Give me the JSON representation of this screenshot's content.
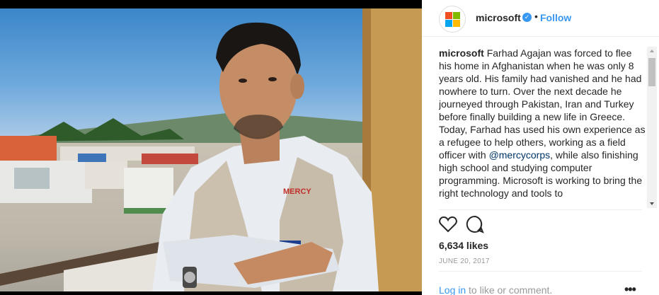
{
  "post": {
    "username": "microsoft",
    "follow_label": "Follow",
    "separator": "•",
    "verified_glyph": "✓",
    "caption_user": "microsoft",
    "caption_part1": "Farhad Agajan was forced to flee his home in Afghanistan when he was only 8 years old. His family had vanished and he had nowhere to turn. Over the next decade he journeyed through Pakistan, Iran and Turkey before finally building a new life in Greece. Today, Farhad has used his own experience as a refugee to help others, working as a field officer with",
    "mention": "@mercycorps",
    "caption_part2": ", while also finishing high school and studying computer programming. Microsoft is working to bring the right technology and tools to",
    "likes": "6,634 likes",
    "date": "JUNE 20, 2017",
    "login_link": "Log in",
    "login_rest": " to like or comment.",
    "more_label": "•••"
  },
  "colors": {
    "accent": "#3897f0",
    "text": "#262626",
    "muted": "#999999",
    "logo_red": "#f25022",
    "logo_green": "#7fba00",
    "logo_blue": "#00a4ef",
    "logo_yellow": "#ffb900"
  },
  "icons": {
    "like": "heart-icon",
    "comment": "comment-icon",
    "verified": "verified-badge-icon",
    "more": "more-options-icon"
  }
}
